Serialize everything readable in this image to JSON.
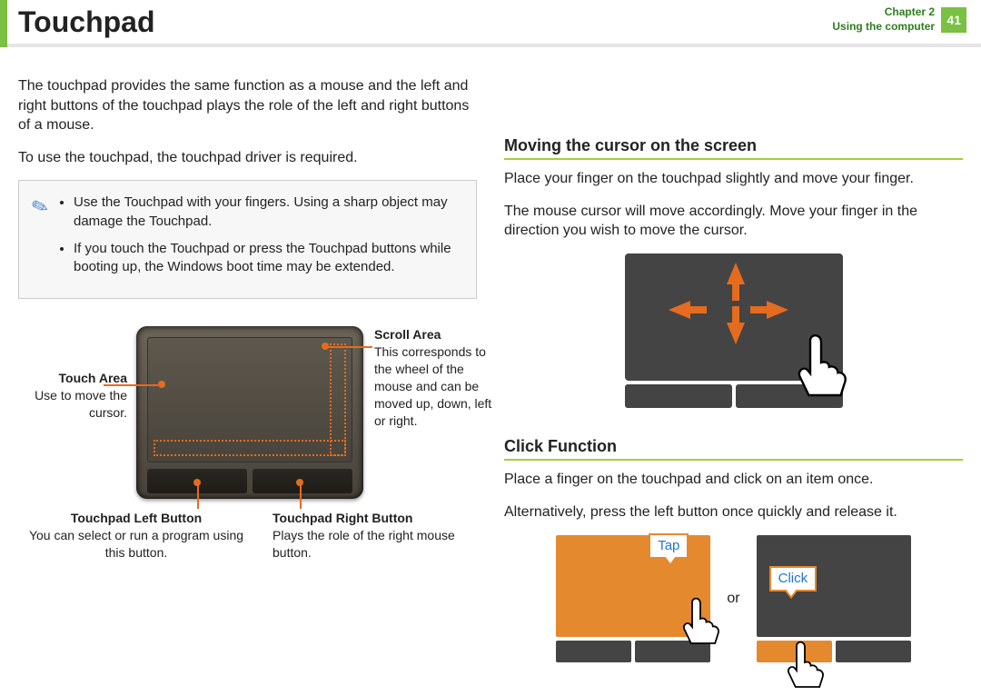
{
  "header": {
    "title": "Touchpad",
    "chapter_line1": "Chapter 2",
    "chapter_line2": "Using the computer",
    "page_number": "41"
  },
  "left": {
    "intro_p1": "The touchpad provides the same function as a mouse and the left and right buttons of the touchpad plays the role of the left and right buttons of a mouse.",
    "intro_p2": "To use the touchpad, the touchpad driver is required.",
    "note": {
      "bullets": [
        "Use the Touchpad with your ﬁngers. Using a sharp object may damage the Touchpad.",
        "If you touch the Touchpad or press the Touchpad buttons while booting up, the Windows boot time may be extended."
      ]
    },
    "callouts": {
      "touch_area_title": "Touch Area",
      "touch_area_desc": "Use to move the cursor.",
      "scroll_area_title": "Scroll Area",
      "scroll_area_desc": "This corresponds to the wheel of the mouse and can be moved up, down, left or right.",
      "left_btn_title": "Touchpad Left Button",
      "left_btn_desc": "You can select or run a program using this button.",
      "right_btn_title": "Touchpad Right Button",
      "right_btn_desc": "Plays the role of the right mouse button."
    }
  },
  "right": {
    "section1_title": "Moving the cursor on the screen",
    "section1_p1": "Place your ﬁnger on the touchpad slightly and move your ﬁnger.",
    "section1_p2": "The mouse cursor will move accordingly. Move your ﬁnger in the direction you wish to move the cursor.",
    "section2_title": "Click Function",
    "section2_p1": "Place a ﬁnger on the touchpad and click on an item once.",
    "section2_p2": "Alternatively, press the left button once quickly and release it.",
    "tap_label": "Tap",
    "click_label": "Click",
    "or_label": "or"
  }
}
